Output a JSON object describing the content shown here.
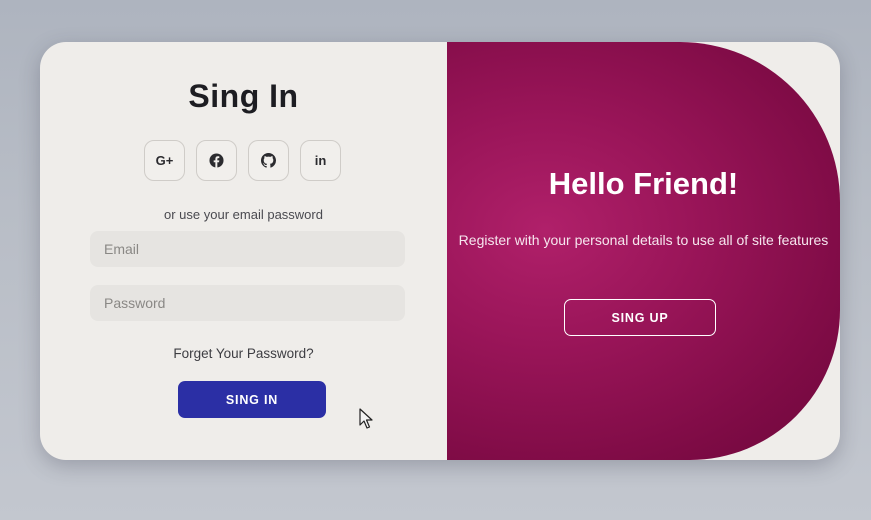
{
  "signin": {
    "title": "Sing In",
    "social_buttons": [
      {
        "label": "G+",
        "icon": "google-plus-icon"
      },
      {
        "label": "",
        "icon": "facebook-icon"
      },
      {
        "label": "",
        "icon": "github-icon"
      },
      {
        "label": "in",
        "icon": "linkedin-icon"
      }
    ],
    "subtitle": "or use your email password",
    "email_placeholder": "Email",
    "password_placeholder": "Password",
    "forgot_link": "Forget Your Password?",
    "submit_label": "SING IN"
  },
  "welcome": {
    "title": "Hello Friend!",
    "message": "Register with your personal details to use all of site features",
    "signup_label": "SING UP"
  },
  "colors": {
    "primary_button": "#2b2fa5",
    "panel_accent": "#9a1559",
    "card_background": "#efedea"
  }
}
